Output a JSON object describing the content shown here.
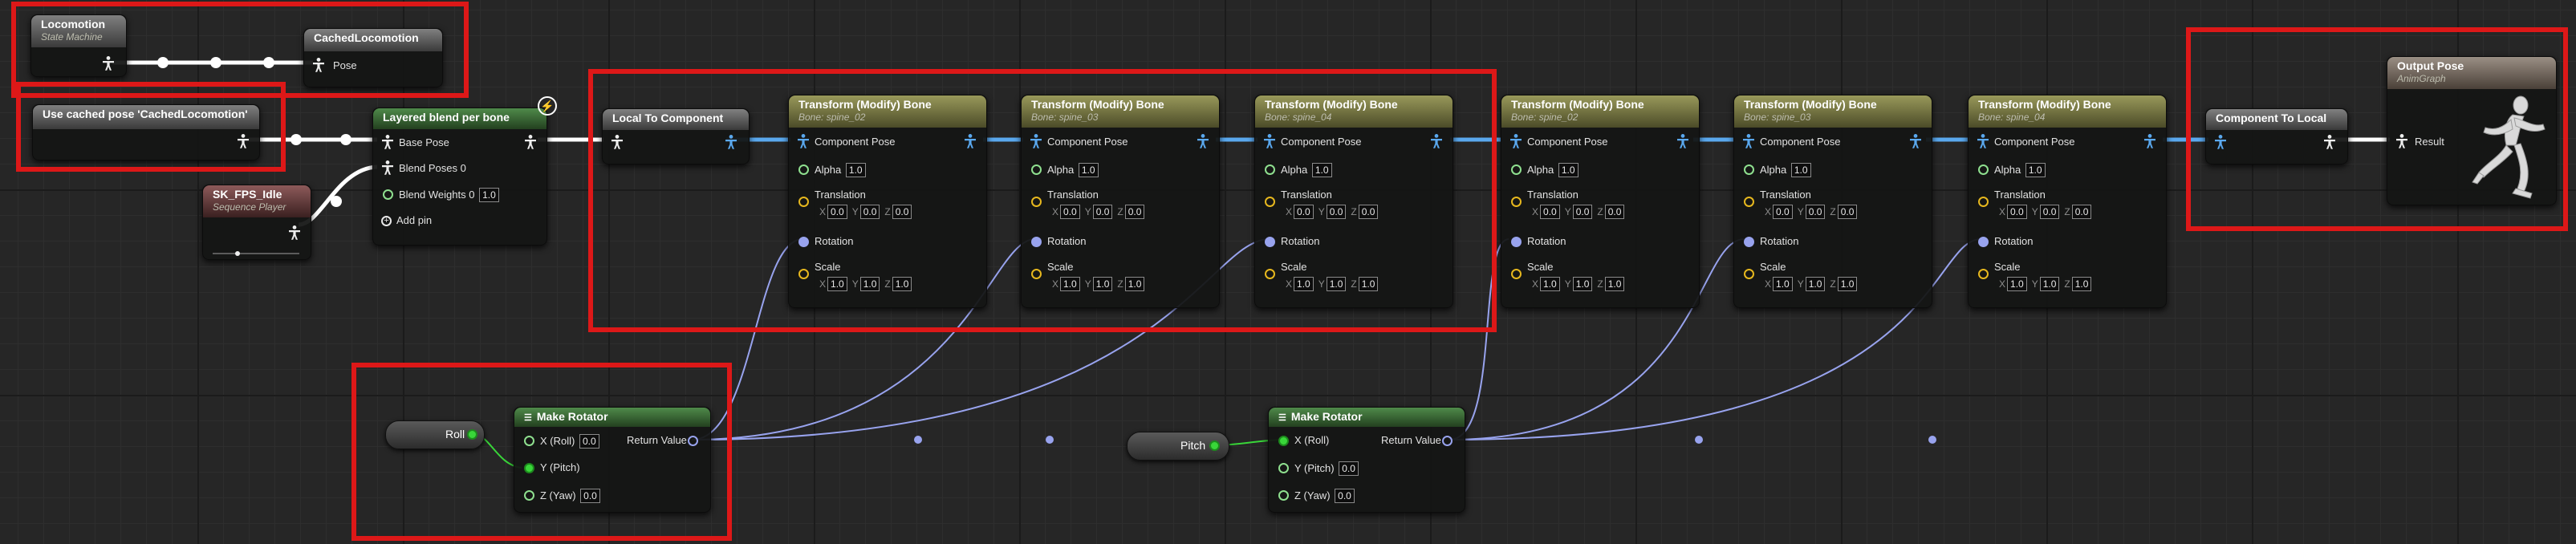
{
  "graph": {
    "nodes": {
      "locomotion": {
        "title": "Locomotion",
        "subtitle": "State Machine"
      },
      "cached_locomotion": {
        "title": "CachedLocomotion",
        "pin": "Pose"
      },
      "use_cached": {
        "title": "Use cached pose 'CachedLocomotion'"
      },
      "sk_fps_idle": {
        "title": "SK_FPS_Idle",
        "subtitle": "Sequence Player"
      },
      "layered_blend": {
        "title": "Layered blend per bone",
        "base_pose": "Base Pose",
        "blend_poses": "Blend Poses 0",
        "blend_weights": "Blend Weights 0",
        "blend_weights_value": "1.0",
        "add_pin": "Add pin"
      },
      "local_to_component": {
        "title": "Local To Component"
      },
      "component_to_local": {
        "title": "Component To Local"
      },
      "output_pose": {
        "title": "Output Pose",
        "subtitle": "AnimGraph",
        "pin": "Result"
      },
      "make_rotator_roll": {
        "title": "Make Rotator",
        "x": "X (Roll)",
        "x_value": "0.0",
        "y": "Y (Pitch)",
        "y_value": "",
        "z": "Z (Yaw)",
        "z_value": "0.0",
        "return": "Return Value"
      },
      "make_rotator_pitch": {
        "title": "Make Rotator",
        "x": "X (Roll)",
        "x_value": "",
        "y": "Y (Pitch)",
        "y_value": "0.0",
        "z": "Z (Yaw)",
        "z_value": "0.0",
        "return": "Return Value"
      },
      "roll_var": {
        "label": "Roll"
      },
      "pitch_var": {
        "label": "Pitch"
      }
    },
    "transform_bone_common": {
      "title": "Transform (Modify) Bone",
      "component_pose": "Component Pose",
      "alpha": "Alpha",
      "alpha_value": "1.0",
      "translation": "Translation",
      "rotation": "Rotation",
      "scale": "Scale",
      "axis_x": "X",
      "axis_y": "Y",
      "axis_z": "Z",
      "translation_values": [
        "0.0",
        "0.0",
        "0.0"
      ],
      "scale_values": [
        "1.0",
        "1.0",
        "1.0"
      ]
    },
    "transform_bones": [
      {
        "subtitle": "Bone: spine_02"
      },
      {
        "subtitle": "Bone: spine_03"
      },
      {
        "subtitle": "Bone: spine_04"
      },
      {
        "subtitle": "Bone: spine_02"
      },
      {
        "subtitle": "Bone: spine_03"
      },
      {
        "subtitle": "Bone: spine_04"
      }
    ],
    "icons": [
      "pose-pin-icon",
      "float-pin-icon",
      "vector-pin-icon",
      "rotator-pin-icon",
      "fast-path-bolt-icon",
      "mannequin-preview-icon",
      "make-rotator-node-icon"
    ],
    "colors": {
      "highlight": "#dd1818",
      "pose_wire": "#ffffff",
      "component_pose_wire": "#5aa8ee",
      "rotator_wire": "#98a3ee",
      "float_pin": "#39d639",
      "vector_pin": "#e7b81e"
    }
  }
}
